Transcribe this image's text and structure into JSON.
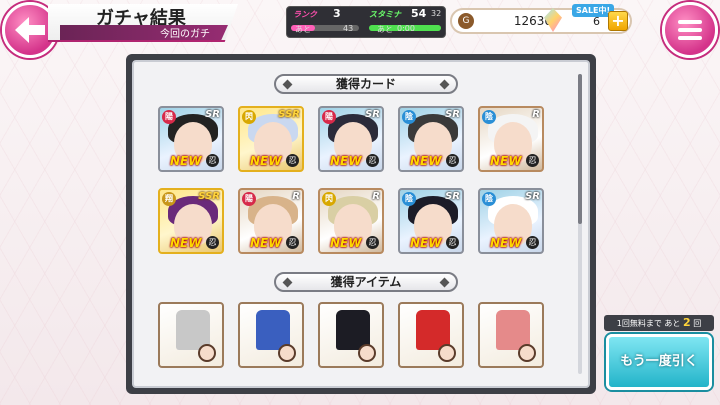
{
  "header": {
    "title": "ガチャ結果",
    "subtitle": "今回のガチ"
  },
  "stats": {
    "rank_label": "ランク",
    "rank_value": "3",
    "rank_remaining_label": "あと",
    "rank_remaining": "43",
    "stamina_label": "スタミナ",
    "stamina_value": "54",
    "stamina_max": "32",
    "stamina_time_label": "あと",
    "stamina_time": "0:00"
  },
  "currency": {
    "coins": "12630",
    "sale_badge": "SALE中!",
    "gems": "6",
    "plus": "+"
  },
  "sections": {
    "cards_title": "獲得カード",
    "items_title": "獲得アイテム"
  },
  "cards": [
    {
      "attr": "陽",
      "attr_color": "#d62a4a",
      "rarity": "SR",
      "new": "NEW",
      "kanji": "忍",
      "hair": "#222222",
      "style": "normal"
    },
    {
      "attr": "閃",
      "attr_color": "#d8a800",
      "rarity": "SSR",
      "new": "NEW",
      "kanji": "忍",
      "hair": "#c9d8f0",
      "style": "ssr"
    },
    {
      "attr": "陽",
      "attr_color": "#d62a4a",
      "rarity": "SR",
      "new": "NEW",
      "kanji": "忍",
      "hair": "#2b2b3a",
      "style": "normal"
    },
    {
      "attr": "陰",
      "attr_color": "#2a8fd6",
      "rarity": "SR",
      "new": "NEW",
      "kanji": "忍",
      "hair": "#3a3a3a",
      "style": "normal"
    },
    {
      "attr": "陰",
      "attr_color": "#2a8fd6",
      "rarity": "R",
      "new": "NEW",
      "kanji": "忍",
      "hair": "#f4f4f4",
      "style": "rare"
    },
    {
      "attr": "翔",
      "attr_color": "#c8961a",
      "rarity": "SSR",
      "new": "NEW",
      "kanji": "忍",
      "hair": "#6a2a7a",
      "style": "ssr"
    },
    {
      "attr": "陽",
      "attr_color": "#d62a4a",
      "rarity": "R",
      "new": "NEW",
      "kanji": "忍",
      "hair": "#d8b38a",
      "style": "rare"
    },
    {
      "attr": "閃",
      "attr_color": "#d8a800",
      "rarity": "R",
      "new": "NEW",
      "kanji": "忍",
      "hair": "#d9cfa4",
      "style": "rare"
    },
    {
      "attr": "陰",
      "attr_color": "#2a8fd6",
      "rarity": "SR",
      "new": "NEW",
      "kanji": "忍",
      "hair": "#1c1c28",
      "style": "normal"
    },
    {
      "attr": "陰",
      "attr_color": "#2a8fd6",
      "rarity": "SR",
      "new": "NEW",
      "kanji": "忍",
      "hair": "#ffffff",
      "style": "normal"
    }
  ],
  "items": [
    {
      "cloth": "#c8c8c8"
    },
    {
      "cloth": "#3a5fbf"
    },
    {
      "cloth": "#1c1c24"
    },
    {
      "cloth": "#d42a2a"
    },
    {
      "cloth": "#e58a8a"
    }
  ],
  "draw": {
    "free_prefix": "1回無料まで あと",
    "free_count": "2",
    "free_suffix": "回",
    "button_label": "もう一度引く"
  }
}
